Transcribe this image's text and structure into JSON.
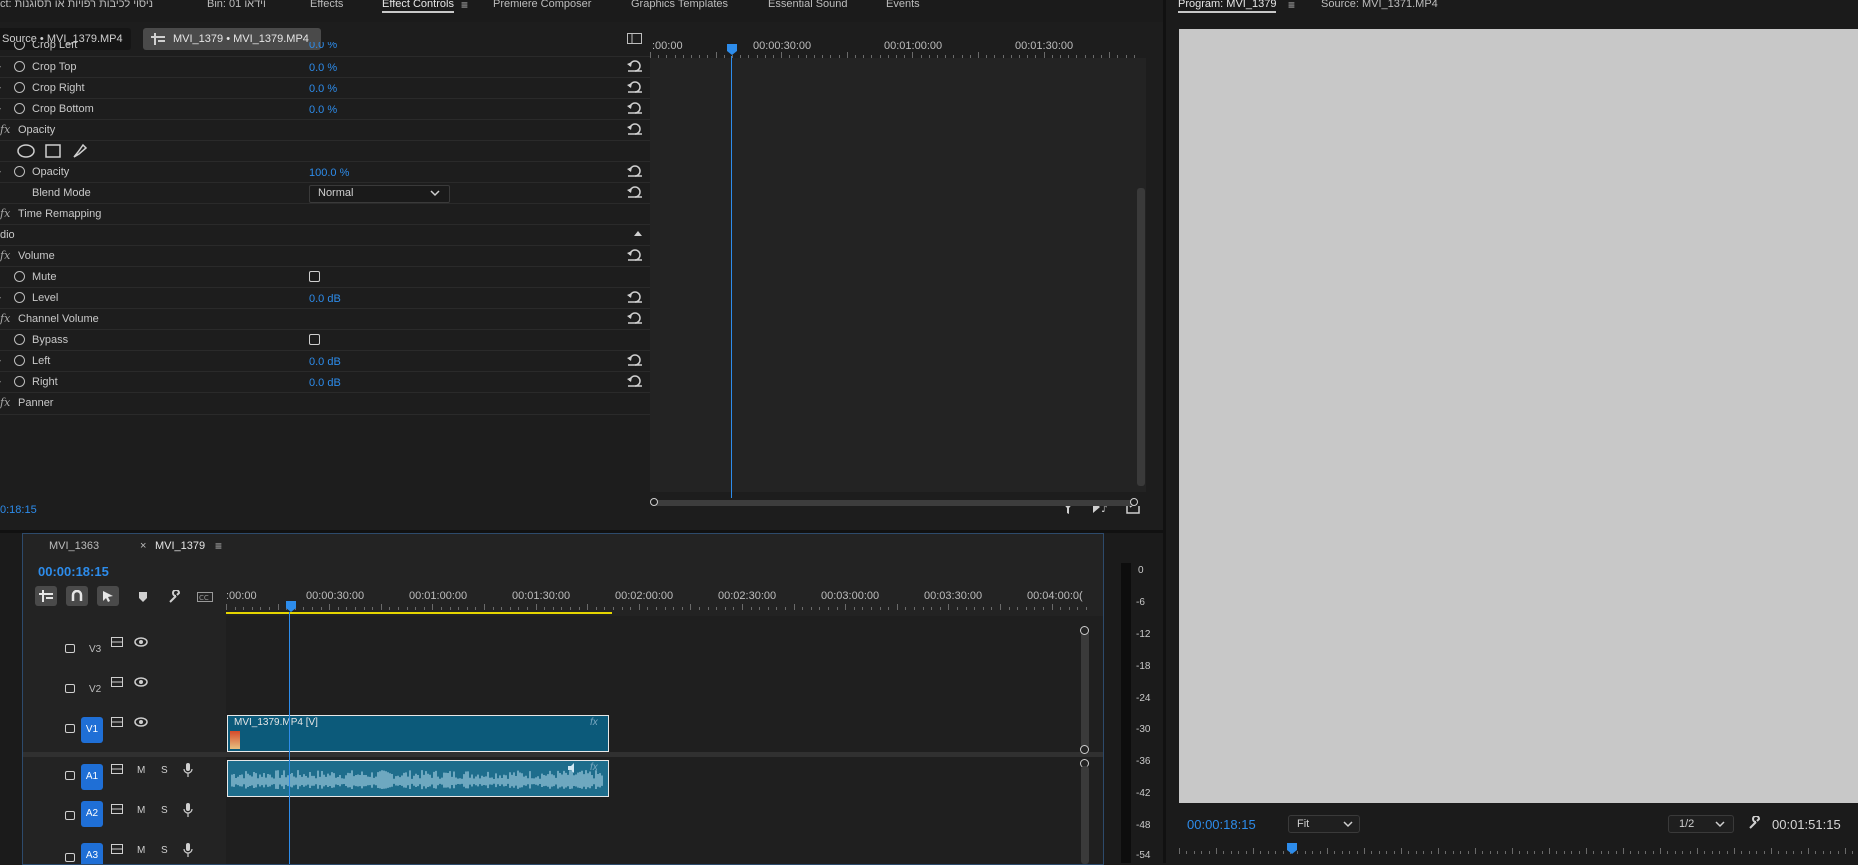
{
  "workspace_bar": {
    "project_label": "ct: ניסוי לכיבות רפויות או תסוגנות",
    "bin_label": "Bin: 01 וידאו",
    "tabs": [
      "Effects",
      "Effect Controls",
      "Premiere Composer",
      "Graphics Templates",
      "Essential Sound",
      "Events"
    ],
    "active_tab": "Effect Controls"
  },
  "effect_controls": {
    "source_tab": "Source • MVI_1379.MP4",
    "clip_tab": "MVI_1379 • MVI_1379.MP4",
    "rows": [
      {
        "label": "Crop Left",
        "value": "0.0 %"
      },
      {
        "label": "Crop Top",
        "value": "0.0 %"
      },
      {
        "label": "Crop Right",
        "value": "0.0 %"
      },
      {
        "label": "Crop Bottom",
        "value": "0.0 %"
      },
      {
        "label": "Opacity",
        "value": ""
      },
      {
        "label": "Opacity",
        "value": "100.0 %"
      },
      {
        "label": "Blend Mode",
        "value": "Normal"
      },
      {
        "label": "Time Remapping",
        "value": ""
      },
      {
        "label": "dio",
        "value": ""
      },
      {
        "label": "Volume",
        "value": ""
      },
      {
        "label": "Mute",
        "value": ""
      },
      {
        "label": "Level",
        "value": "0.0 dB"
      },
      {
        "label": "Channel Volume",
        "value": ""
      },
      {
        "label": "Bypass",
        "value": ""
      },
      {
        "label": "Left",
        "value": "0.0 dB"
      },
      {
        "label": "Right",
        "value": "0.0 dB"
      },
      {
        "label": "Panner",
        "value": ""
      }
    ],
    "timecode": "0:18:15",
    "ruler_labels": [
      ":00:00",
      "00:00:30:00",
      "00:01:00:00",
      "00:01:30:00"
    ]
  },
  "program_monitor": {
    "title": "Program: MVI_1379",
    "source_title": "Source: MVI_1371.MP4",
    "timecode": "00:00:18:15",
    "fit_label": "Fit",
    "resolution_label": "1/2",
    "duration": "00:01:51:15"
  },
  "sequence": {
    "tabs": [
      "MVI_1363",
      "MVI_1379"
    ],
    "close_symbol": "×",
    "menu_symbol": "≡",
    "timecode": "00:00:18:15",
    "ruler_labels": [
      ":00:00",
      "00:00:30:00",
      "00:01:00:00",
      "00:01:30:00",
      "00:02:00:00",
      "00:02:30:00",
      "00:03:00:00",
      "00:03:30:00",
      "00:04:00:0("
    ],
    "video_tracks": [
      "V3",
      "V2",
      "V1"
    ],
    "audio_tracks": [
      "A1",
      "A2",
      "A3"
    ],
    "mute_label": "M",
    "solo_label": "S",
    "video_clip": "MVI_1379.MP4 [V]",
    "fx_label": "fx"
  },
  "audio_meter": {
    "labels": [
      "0",
      "-6",
      "-12",
      "-18",
      "-24",
      "-30",
      "-36",
      "-42",
      "-48",
      "-54"
    ]
  }
}
